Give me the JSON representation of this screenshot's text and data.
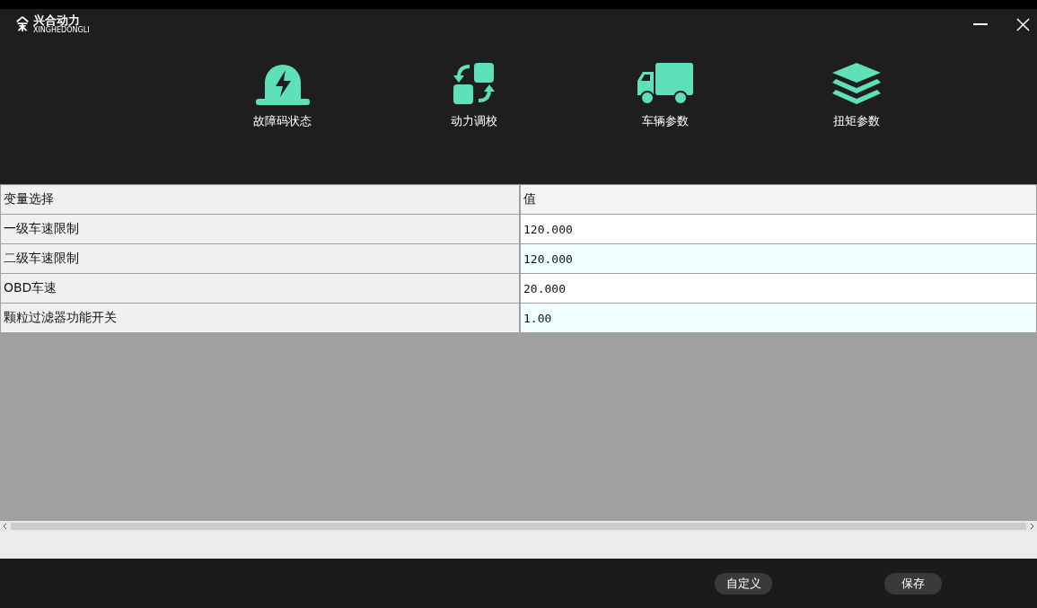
{
  "brand": {
    "name": "兴合动力",
    "subtitle": "XINGHEDONGLI"
  },
  "nav": [
    {
      "label": "故障码状态",
      "kind": "alarm"
    },
    {
      "label": "动力调校",
      "kind": "swap"
    },
    {
      "label": "车辆参数",
      "kind": "truck"
    },
    {
      "label": "扭矩参数",
      "kind": "layers"
    }
  ],
  "table": {
    "columns": [
      "变量选择",
      "值"
    ],
    "rows": [
      {
        "name": "一级车速限制",
        "value": "120.000"
      },
      {
        "name": "二级车速限制",
        "value": "120.000"
      },
      {
        "name": "OBD车速",
        "value": "20.000"
      },
      {
        "name": "颗粒过滤器功能开关",
        "value": "1.00"
      }
    ]
  },
  "buttons": [
    "自定义",
    "保存"
  ]
}
